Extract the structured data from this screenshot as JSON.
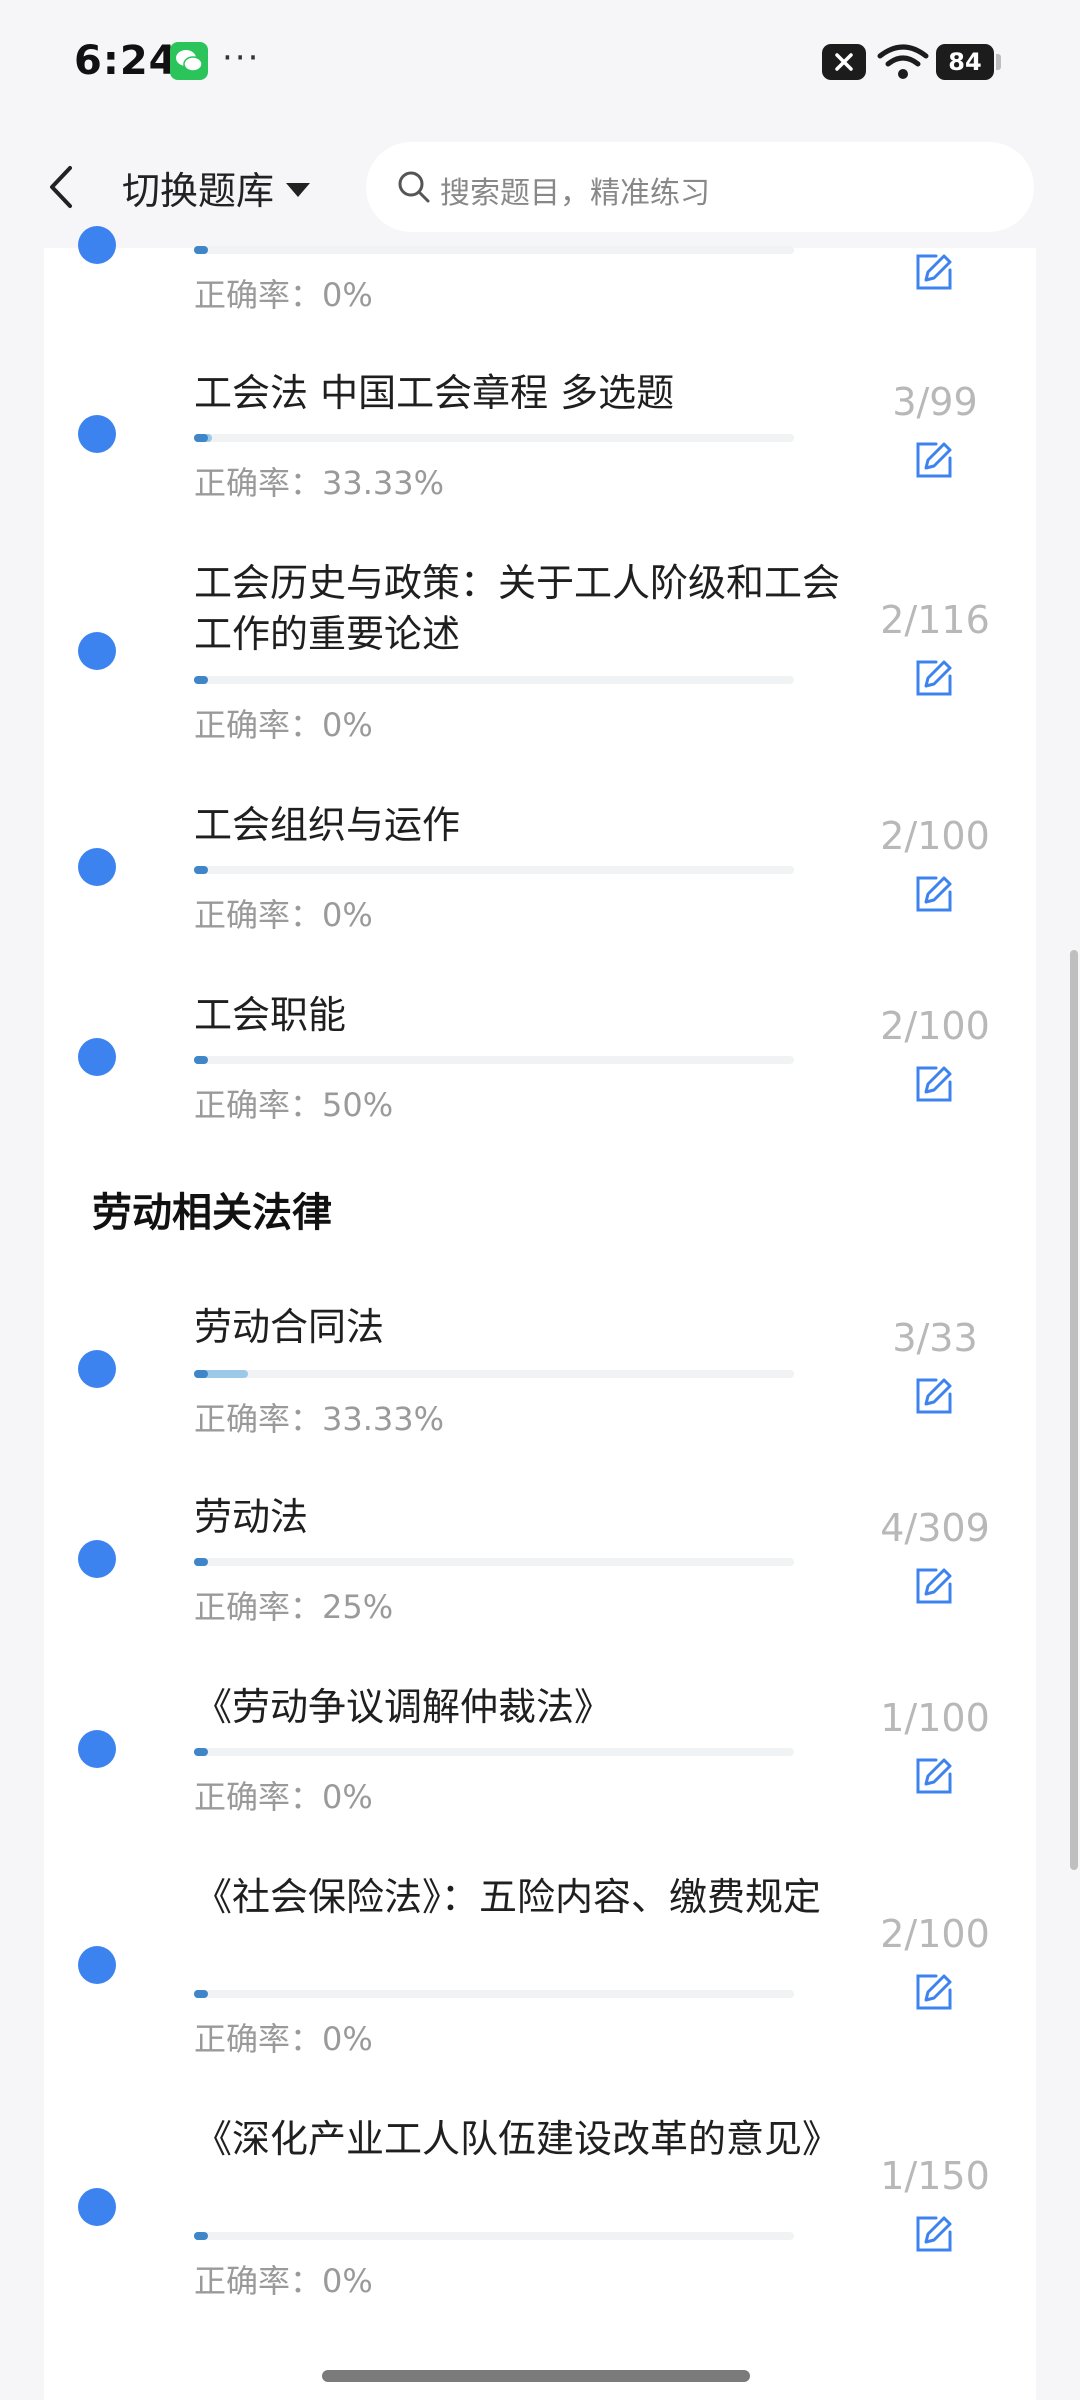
{
  "status_bar": {
    "time": "6:24",
    "dots": "···",
    "battery": "84"
  },
  "header": {
    "switch_label": "切换题库",
    "search_placeholder": "搜索题目，精准练习"
  },
  "partial_top": {
    "rate": "正确率：0%",
    "progress": 0.02
  },
  "groups": [
    {
      "heading": "",
      "items": [
        {
          "title": "工会法 中国工会章程 多选题",
          "rate": "正确率：33.33%",
          "count": "3/99",
          "progress": 0.03
        },
        {
          "title": "工会历史与政策：关于工人阶级和工会工作的重要论述",
          "rate": "正确率：0%",
          "count": "2/116",
          "progress": 0.02
        },
        {
          "title": "工会组织与运作",
          "rate": "正确率：0%",
          "count": "2/100",
          "progress": 0.02
        },
        {
          "title": "工会职能",
          "rate": "正确率：50%",
          "count": "2/100",
          "progress": 0.02
        }
      ]
    },
    {
      "heading": "劳动相关法律",
      "items": [
        {
          "title": "劳动合同法",
          "rate": "正确率：33.33%",
          "count": "3/33",
          "progress": 0.09
        },
        {
          "title": "劳动法",
          "rate": "正确率：25%",
          "count": "4/309",
          "progress": 0.013
        },
        {
          "title": "《劳动争议调解仲裁法》",
          "rate": "正确率：0%",
          "count": "1/100",
          "progress": 0.01
        },
        {
          "title": "《社会保险法》：五险内容、缴费规定",
          "rate": "正确率：0%",
          "count": "2/100",
          "progress": 0.02
        },
        {
          "title": "《深化产业工人队伍建设改革的意见》",
          "rate": "正确率：0%",
          "count": "1/150",
          "progress": 0.007
        }
      ]
    }
  ],
  "colors": {
    "accent": "#3c83f0",
    "progress_fill": "#9cc9e8",
    "progress_head": "#3f86c9",
    "muted": "#9a9a9a"
  },
  "icons": [
    "back-chevron-icon",
    "caret-down-icon",
    "search-icon",
    "edit-icon",
    "wechat-icon",
    "wifi-icon"
  ]
}
